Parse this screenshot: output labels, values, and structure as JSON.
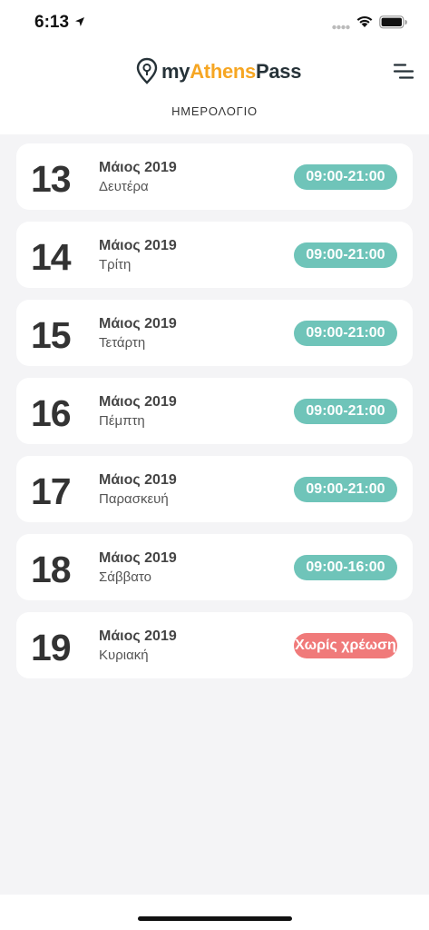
{
  "status_bar": {
    "time": "6:13"
  },
  "header": {
    "logo": {
      "part1": "my",
      "part2": "Athens",
      "part3": "Pass"
    },
    "title": "ΗΜΕΡΟΛΟΓΙΟ"
  },
  "days": [
    {
      "day": "13",
      "month": "Μάιος 2019",
      "weekday": "Δευτέρα",
      "hours": "09:00-21:00",
      "closed": false
    },
    {
      "day": "14",
      "month": "Μάιος 2019",
      "weekday": "Τρίτη",
      "hours": "09:00-21:00",
      "closed": false
    },
    {
      "day": "15",
      "month": "Μάιος 2019",
      "weekday": "Τετάρτη",
      "hours": "09:00-21:00",
      "closed": false
    },
    {
      "day": "16",
      "month": "Μάιος 2019",
      "weekday": "Πέμπτη",
      "hours": "09:00-21:00",
      "closed": false
    },
    {
      "day": "17",
      "month": "Μάιος 2019",
      "weekday": "Παρασκευή",
      "hours": "09:00-21:00",
      "closed": false
    },
    {
      "day": "18",
      "month": "Μάιος 2019",
      "weekday": "Σάββατο",
      "hours": "09:00-16:00",
      "closed": false
    },
    {
      "day": "19",
      "month": "Μάιος 2019",
      "weekday": "Κυριακή",
      "hours": "Χωρίς χρέωση",
      "closed": true
    }
  ],
  "colors": {
    "open_badge": "#6fc4b9",
    "closed_badge": "#f07a7a",
    "brand_accent": "#f6a623",
    "brand_dark": "#263238"
  },
  "icons": {
    "location": "location-arrow-icon",
    "signal": "cellular-signal-icon",
    "wifi": "wifi-icon",
    "battery": "battery-icon",
    "logo": "map-pin-icon",
    "menu": "hamburger-menu-icon"
  }
}
